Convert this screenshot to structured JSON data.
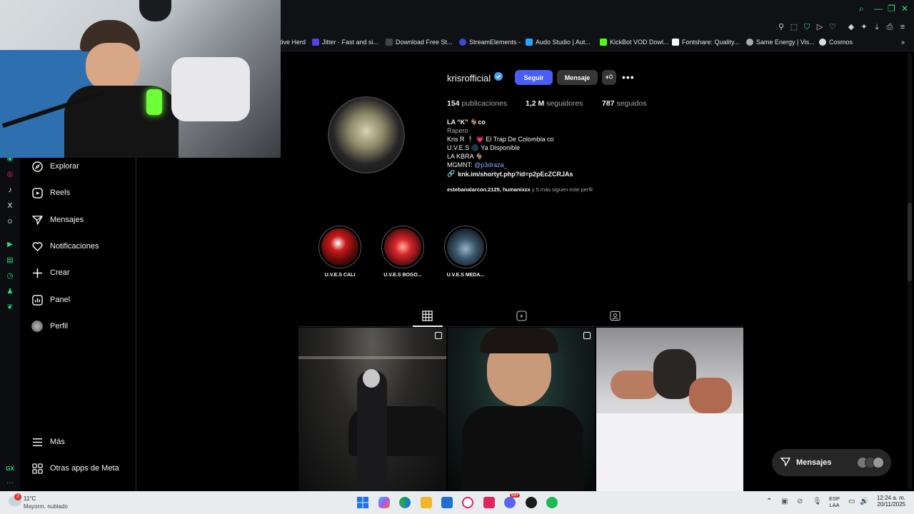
{
  "browser": {
    "bookmarks": [
      {
        "label": "tive Herd",
        "color": "#888888"
      },
      {
        "label": "Jitter · Fast and si...",
        "color": "#5a3ee6"
      },
      {
        "label": "Download Free St...",
        "color": "#444444"
      },
      {
        "label": "StreamElements -",
        "color": "#3b4bd6"
      },
      {
        "label": "Audo Studio | Aut...",
        "color": "#2aa3ff"
      },
      {
        "label": "KickBot VOD Dowl...",
        "color": "#53fc18"
      },
      {
        "label": "Fontshare: Quality...",
        "color": "#ffffff"
      },
      {
        "label": "Same Energy | Vis...",
        "color": "#aaaaaa"
      },
      {
        "label": "Cosmos",
        "color": "#dddddd"
      }
    ]
  },
  "nav": {
    "items": [
      {
        "label": "Explorar",
        "icon": "compass-icon"
      },
      {
        "label": "Reels",
        "icon": "reels-icon"
      },
      {
        "label": "Mensajes",
        "icon": "send-icon"
      },
      {
        "label": "Notificaciones",
        "icon": "heart-icon"
      },
      {
        "label": "Crear",
        "icon": "plus-icon"
      },
      {
        "label": "Panel",
        "icon": "chart-icon"
      },
      {
        "label": "Perfil",
        "icon": "avatar"
      }
    ],
    "more": "Más",
    "meta_apps": "Otras apps de Meta"
  },
  "profile": {
    "username": "krisrofficial",
    "follow_label": "Seguir",
    "message_label": "Mensaje",
    "posts_count": "154",
    "posts_label": "publicaciones",
    "followers_count": "1,2 M",
    "followers_label": "seguidores",
    "following_count": "787",
    "following_label": "seguidos",
    "name": "LA “K” 🐐co",
    "category": "Rapero",
    "bio_lines": [
      "Kris R 🕴🏻 💗 El Trap De Colombia co",
      "U.V.E.S 🌑 Ya Disponible",
      "LA KBRA 🐐",
      "MGMNT: "
    ],
    "mention": "@p3draza_",
    "link": "knk.im/shortyt.php?id=p2pEcZCRJAs",
    "followed_by_users": "estebanalarcon.2125, humanixzx",
    "followed_by_rest": " y 5 más siguen este perfil"
  },
  "highlights": [
    {
      "label": "U.V.E.S CALI"
    },
    {
      "label": "U.V.E.S BOGO..."
    },
    {
      "label": "U.V.E.S MEDA..."
    }
  ],
  "messages_pill": {
    "label": "Mensajes"
  },
  "taskbar": {
    "weather_temp": "11°C",
    "weather_desc": "Mayorm. nublado",
    "weather_badge": "2",
    "lang_top": "ESP",
    "lang_bottom": "LAA",
    "time": "12:24 a. m.",
    "date": "20/11/2025",
    "discord_badge": "99+"
  },
  "colors": {
    "accent": "#4a5df9",
    "gx_green": "#27e07a",
    "background": "#000000"
  }
}
